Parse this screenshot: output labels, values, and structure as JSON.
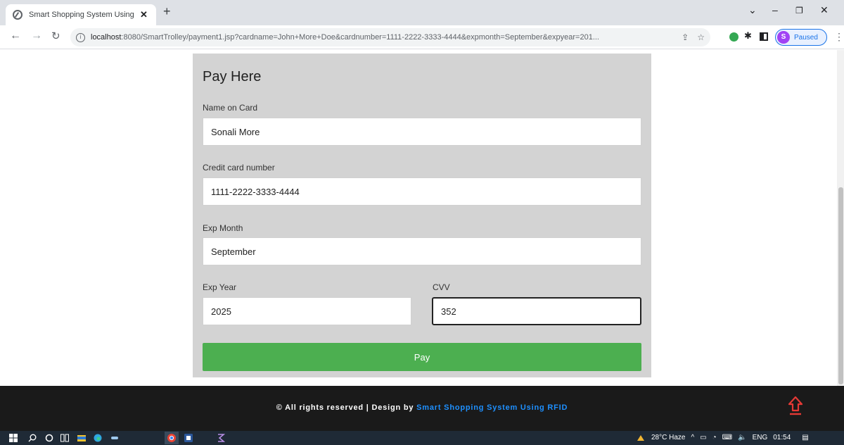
{
  "browser": {
    "tab_title": "Smart Shopping System Using RFI",
    "url_host": "localhost",
    "url_rest": ":8080/SmartTrolley/payment1.jsp?cardname=John+More+Doe&cardnumber=1111-2222-3333-4444&expmonth=September&expyear=201...",
    "profile_initial": "S",
    "profile_status": "Paused"
  },
  "form": {
    "title": "Pay Here",
    "name_label": "Name on Card",
    "name_value": "Sonali More",
    "card_label": "Credit card number",
    "card_value": "1111-2222-3333-4444",
    "month_label": "Exp Month",
    "month_value": "September",
    "year_label": "Exp Year",
    "year_value": "2025",
    "cvv_label": "CVV",
    "cvv_value": "352",
    "pay_label": "Pay"
  },
  "footer": {
    "prefix": "© All rights reserved | Design by ",
    "link": "Smart Shopping System Using RFID"
  },
  "taskbar": {
    "weather": "28°C Haze",
    "lang": "ENG",
    "time": "01:54"
  },
  "colors": {
    "pay_button": "#4caf50",
    "footer_bg": "#1a1a1a",
    "footer_link": "#1e90ff",
    "card_bg": "#d3d3d3",
    "scroll_top_arrow": "#e53935"
  },
  "icons": {
    "tab_favicon": "globe-icon",
    "scroll_top": "arrow-up-icon",
    "start": "windows-icon"
  }
}
